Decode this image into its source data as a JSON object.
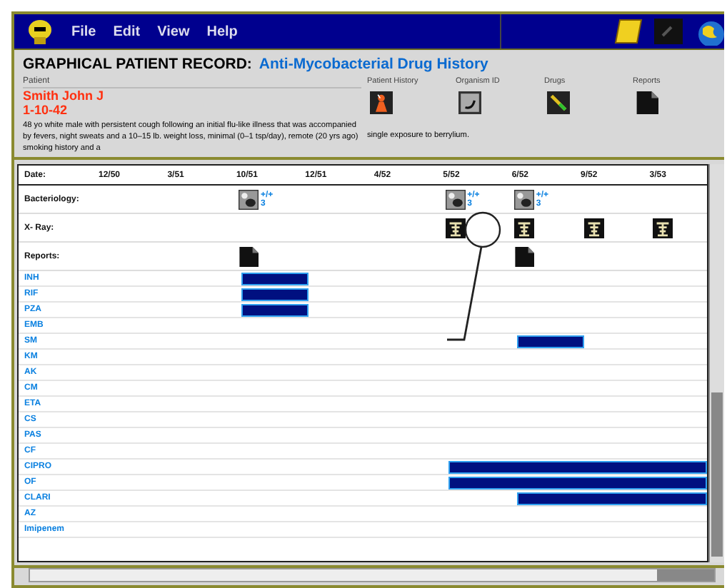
{
  "menu": [
    "File",
    "Edit",
    "View",
    "Help"
  ],
  "title": "GRAPHICAL PATIENT RECORD:",
  "subtitle": "Anti-Mycobacterial Drug History",
  "patient": {
    "label": "Patient",
    "name": "Smith John J",
    "dob": "1-10-42",
    "history": "48 yo white male with persistent cough following an initial flu-like illness that was accompanied by fevers, night sweats and a 10–15 lb. weight loss, minimal (0–1 tsp/day), remote (20 yrs ago) smoking history and a",
    "history_more": "single exposure to berrylium."
  },
  "sections": [
    {
      "label": "Patient History",
      "kind": "history"
    },
    {
      "label": "Organism ID",
      "kind": "organism"
    },
    {
      "label": "Drugs",
      "kind": "drugs"
    },
    {
      "label": "Reports",
      "kind": "reports"
    }
  ],
  "timeline": {
    "date_label": "Date:",
    "dates": [
      "12/50",
      "3/51",
      "10/51",
      "12/51",
      "4/52",
      "5/52",
      "6/52",
      "9/52",
      "3/53"
    ],
    "event_rows": [
      {
        "label": "Bacteriology:",
        "kind": "bacteriology",
        "cells": [
          {
            "kind": "empty"
          },
          {
            "kind": "empty"
          },
          {
            "kind": "icon",
            "result": "+/+",
            "count": "3"
          },
          {
            "kind": "empty"
          },
          {
            "kind": "empty"
          },
          {
            "kind": "icon",
            "result": "+/+",
            "count": "3"
          },
          {
            "kind": "icon",
            "result": "+/+",
            "count": "3"
          },
          {
            "kind": "empty"
          },
          {
            "kind": "empty"
          }
        ]
      },
      {
        "label": "X- Ray:",
        "kind": "xray",
        "cells": [
          {
            "kind": "empty"
          },
          {
            "kind": "empty"
          },
          {
            "kind": "empty"
          },
          {
            "kind": "empty"
          },
          {
            "kind": "empty"
          },
          {
            "kind": "icon"
          },
          {
            "kind": "icon"
          },
          {
            "kind": "icon"
          },
          {
            "kind": "icon"
          }
        ]
      },
      {
        "label": "Reports:",
        "kind": "report",
        "cells": [
          {
            "kind": "empty"
          },
          {
            "kind": "empty"
          },
          {
            "kind": "icon"
          },
          {
            "kind": "empty"
          },
          {
            "kind": "empty"
          },
          {
            "kind": "empty"
          },
          {
            "kind": "icon"
          },
          {
            "kind": "empty"
          },
          {
            "kind": "empty"
          }
        ]
      }
    ],
    "drugs": [
      {
        "name": "INH",
        "cells": [
          {
            "kind": "gap"
          },
          {
            "kind": "gap"
          },
          {
            "kind": "bar"
          },
          {
            "kind": "gap"
          },
          {
            "kind": "gap"
          },
          {
            "kind": "gap"
          },
          {
            "kind": "gap"
          },
          {
            "kind": "gap"
          },
          {
            "kind": "gap"
          }
        ]
      },
      {
        "name": "RIF",
        "cells": [
          {
            "kind": "gap"
          },
          {
            "kind": "gap"
          },
          {
            "kind": "bar"
          },
          {
            "kind": "gap"
          },
          {
            "kind": "gap"
          },
          {
            "kind": "gap"
          },
          {
            "kind": "gap"
          },
          {
            "kind": "gap"
          },
          {
            "kind": "gap"
          }
        ]
      },
      {
        "name": "PZA",
        "cells": [
          {
            "kind": "gap"
          },
          {
            "kind": "gap"
          },
          {
            "kind": "bar"
          },
          {
            "kind": "gap"
          },
          {
            "kind": "gap"
          },
          {
            "kind": "gap"
          },
          {
            "kind": "gap"
          },
          {
            "kind": "gap"
          },
          {
            "kind": "gap"
          }
        ]
      },
      {
        "name": "EMB",
        "cells": [
          {
            "kind": "gap"
          },
          {
            "kind": "gap"
          },
          {
            "kind": "gap"
          },
          {
            "kind": "gap"
          },
          {
            "kind": "gap"
          },
          {
            "kind": "gap"
          },
          {
            "kind": "gap"
          },
          {
            "kind": "gap"
          },
          {
            "kind": "gap"
          }
        ]
      },
      {
        "name": "SM",
        "cells": [
          {
            "kind": "gap"
          },
          {
            "kind": "gap"
          },
          {
            "kind": "gap"
          },
          {
            "kind": "gap"
          },
          {
            "kind": "gap"
          },
          {
            "kind": "gap"
          },
          {
            "kind": "bar"
          },
          {
            "kind": "gap"
          },
          {
            "kind": "gap"
          }
        ]
      },
      {
        "name": "KM",
        "cells": [
          {
            "kind": "gap"
          },
          {
            "kind": "gap"
          },
          {
            "kind": "gap"
          },
          {
            "kind": "gap"
          },
          {
            "kind": "gap"
          },
          {
            "kind": "gap"
          },
          {
            "kind": "gap"
          },
          {
            "kind": "gap"
          },
          {
            "kind": "gap"
          }
        ]
      },
      {
        "name": "AK",
        "cells": [
          {
            "kind": "gap"
          },
          {
            "kind": "gap"
          },
          {
            "kind": "gap"
          },
          {
            "kind": "gap"
          },
          {
            "kind": "gap"
          },
          {
            "kind": "gap"
          },
          {
            "kind": "gap"
          },
          {
            "kind": "gap"
          },
          {
            "kind": "gap"
          }
        ]
      },
      {
        "name": "CM",
        "cells": [
          {
            "kind": "gap"
          },
          {
            "kind": "gap"
          },
          {
            "kind": "gap"
          },
          {
            "kind": "gap"
          },
          {
            "kind": "gap"
          },
          {
            "kind": "gap"
          },
          {
            "kind": "gap"
          },
          {
            "kind": "gap"
          },
          {
            "kind": "gap"
          }
        ]
      },
      {
        "name": "ETA",
        "cells": [
          {
            "kind": "gap"
          },
          {
            "kind": "gap"
          },
          {
            "kind": "gap"
          },
          {
            "kind": "gap"
          },
          {
            "kind": "gap"
          },
          {
            "kind": "gap"
          },
          {
            "kind": "gap"
          },
          {
            "kind": "gap"
          },
          {
            "kind": "gap"
          }
        ]
      },
      {
        "name": "CS",
        "cells": [
          {
            "kind": "gap"
          },
          {
            "kind": "gap"
          },
          {
            "kind": "gap"
          },
          {
            "kind": "gap"
          },
          {
            "kind": "gap"
          },
          {
            "kind": "gap"
          },
          {
            "kind": "gap"
          },
          {
            "kind": "gap"
          },
          {
            "kind": "gap"
          }
        ]
      },
      {
        "name": "PAS",
        "cells": [
          {
            "kind": "gap"
          },
          {
            "kind": "gap"
          },
          {
            "kind": "gap"
          },
          {
            "kind": "gap"
          },
          {
            "kind": "gap"
          },
          {
            "kind": "gap"
          },
          {
            "kind": "gap"
          },
          {
            "kind": "gap"
          },
          {
            "kind": "gap"
          }
        ]
      },
      {
        "name": "CF",
        "cells": [
          {
            "kind": "gap"
          },
          {
            "kind": "gap"
          },
          {
            "kind": "gap"
          },
          {
            "kind": "gap"
          },
          {
            "kind": "gap"
          },
          {
            "kind": "gap"
          },
          {
            "kind": "gap"
          },
          {
            "kind": "gap"
          },
          {
            "kind": "gap"
          }
        ]
      },
      {
        "name": "CIPRO",
        "cells": [
          {
            "kind": "gap"
          },
          {
            "kind": "gap"
          },
          {
            "kind": "gap"
          },
          {
            "kind": "gap"
          },
          {
            "kind": "gap"
          },
          {
            "kind": "bar"
          },
          {
            "kind": "bar"
          },
          {
            "kind": "bar"
          },
          {
            "kind": "bar"
          }
        ]
      },
      {
        "name": "OF",
        "cells": [
          {
            "kind": "gap"
          },
          {
            "kind": "gap"
          },
          {
            "kind": "gap"
          },
          {
            "kind": "gap"
          },
          {
            "kind": "gap"
          },
          {
            "kind": "bar"
          },
          {
            "kind": "bar"
          },
          {
            "kind": "bar"
          },
          {
            "kind": "bar"
          }
        ]
      },
      {
        "name": "CLARI",
        "cells": [
          {
            "kind": "gap"
          },
          {
            "kind": "gap"
          },
          {
            "kind": "gap"
          },
          {
            "kind": "gap"
          },
          {
            "kind": "gap"
          },
          {
            "kind": "gap"
          },
          {
            "kind": "bar"
          },
          {
            "kind": "bar"
          },
          {
            "kind": "bar"
          }
        ]
      },
      {
        "name": "AZ",
        "cells": [
          {
            "kind": "gap"
          },
          {
            "kind": "gap"
          },
          {
            "kind": "gap"
          },
          {
            "kind": "gap"
          },
          {
            "kind": "gap"
          },
          {
            "kind": "gap"
          },
          {
            "kind": "gap"
          },
          {
            "kind": "gap"
          },
          {
            "kind": "gap"
          }
        ]
      },
      {
        "name": "Imipenem",
        "cells": [
          {
            "kind": "gap"
          },
          {
            "kind": "gap"
          },
          {
            "kind": "gap"
          },
          {
            "kind": "gap"
          },
          {
            "kind": "gap"
          },
          {
            "kind": "gap"
          },
          {
            "kind": "gap"
          },
          {
            "kind": "gap"
          },
          {
            "kind": "gap"
          }
        ]
      }
    ]
  }
}
